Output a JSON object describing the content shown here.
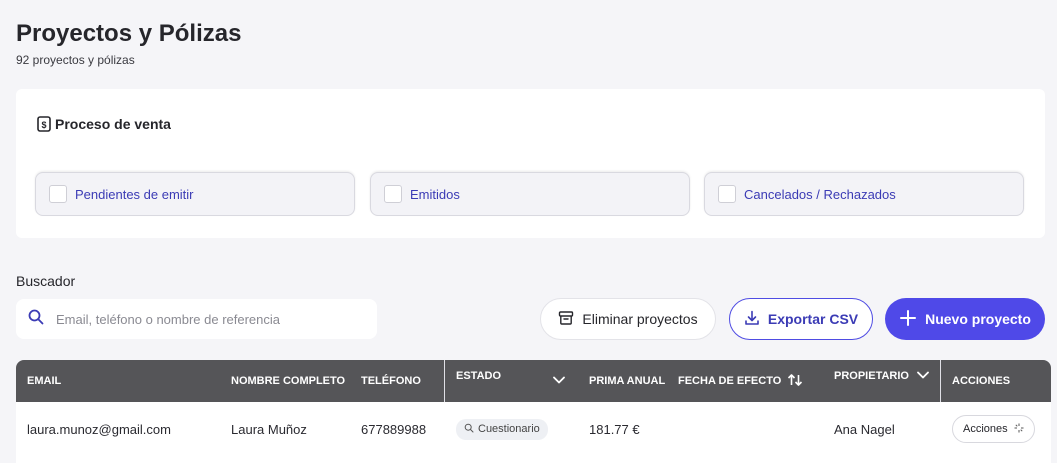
{
  "header": {
    "title": "Proyectos y Pólizas",
    "subtitle": "92 proyectos y pólizas"
  },
  "sales_process": {
    "title": "Proceso de venta",
    "filters": [
      {
        "label": "Pendientes de emitir",
        "checked": false
      },
      {
        "label": "Emitidos",
        "checked": false
      },
      {
        "label": "Cancelados / Rechazados",
        "checked": false
      }
    ]
  },
  "search": {
    "label": "Buscador",
    "placeholder": "Email, teléfono o nombre de referencia",
    "value": ""
  },
  "toolbar": {
    "delete_label": "Eliminar proyectos",
    "export_label": "Exportar CSV",
    "new_label": "Nuevo proyecto"
  },
  "table": {
    "columns": [
      "EMAIL",
      "NOMBRE COMPLETO",
      "TELÉFONO",
      "ESTADO",
      "PRIMA ANUAL",
      "FECHA DE EFECTO",
      "PROPIETARIO",
      "ACCIONES"
    ],
    "rows": [
      {
        "email": "laura.munoz@gmail.com",
        "name": "Laura Muñoz",
        "phone": "677889988",
        "status": "Cuestionario",
        "premium": "181.77 €",
        "effective_date": "",
        "owner": "Ana Nagel",
        "actions": "Acciones"
      }
    ]
  },
  "colors": {
    "accent": "#4f49e8",
    "link": "#3b3bb5",
    "table_header": "#555558",
    "background": "#f5f5f8"
  }
}
